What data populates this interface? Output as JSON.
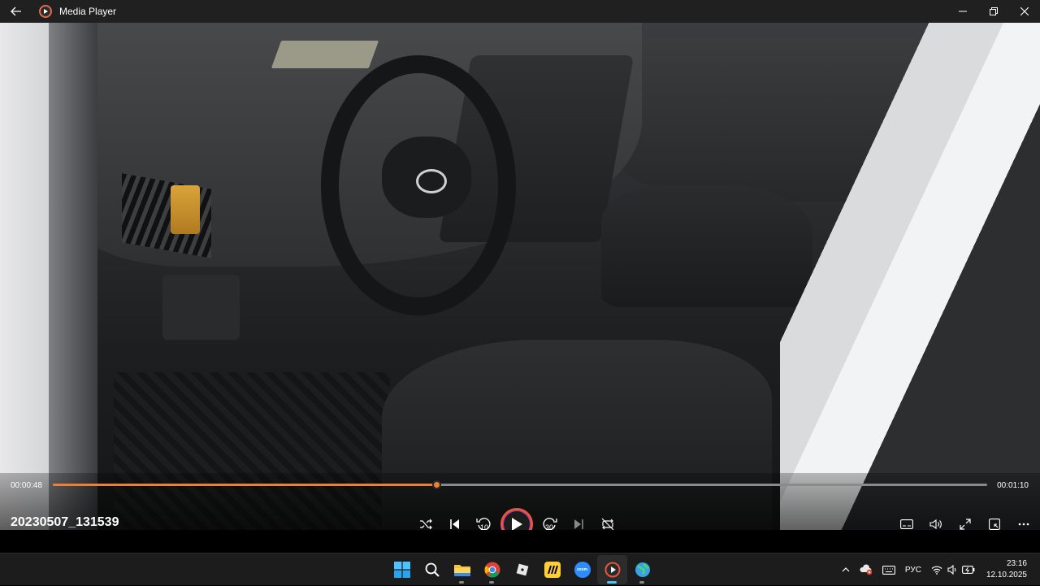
{
  "window": {
    "title": "Media Player"
  },
  "player": {
    "media_title": "20230507_131539",
    "current_time": "00:00:48",
    "duration": "00:01:10",
    "progress_fraction": 0.41,
    "skip_back_seconds": "10",
    "skip_forward_seconds": "30",
    "accent_color": "#f07f34"
  },
  "taskbar": {
    "apps": [
      "start-icon",
      "search-icon",
      "file-explorer-icon",
      "chrome-icon",
      "roblox-icon",
      "miro-icon",
      "zoom-icon",
      "media-player-icon",
      "globe-app-icon"
    ],
    "zoom_label": "zoom",
    "language": "РУС",
    "time": "23:16",
    "date": "12.10.2025"
  }
}
